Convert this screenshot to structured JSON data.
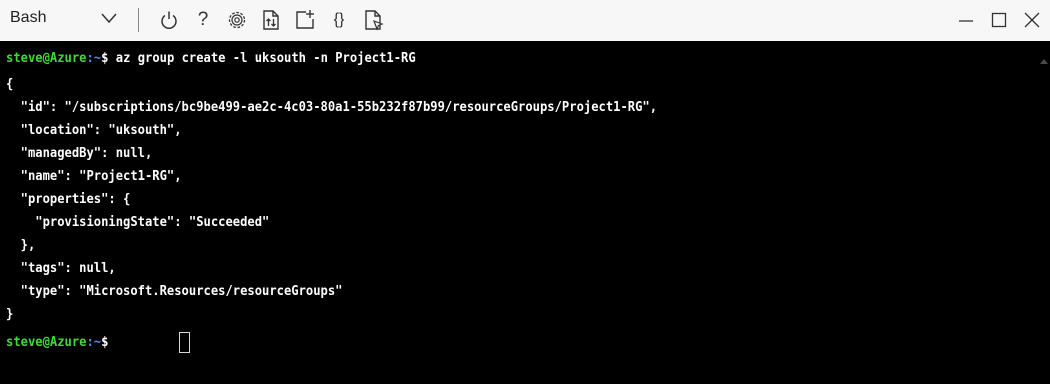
{
  "toolbar": {
    "shell_label": "Bash",
    "icons": {
      "chevron": "chevron-down-icon",
      "power": "power-icon",
      "help": "help-icon",
      "settings": "gear-icon",
      "upload": "upload-download-icon",
      "new_session": "new-session-icon",
      "editor": "braces-icon",
      "preview": "web-preview-icon"
    },
    "help_glyph": "?",
    "editor_glyph": "{}"
  },
  "window": {
    "icons": [
      "minimize-icon",
      "maximize-icon",
      "close-icon"
    ]
  },
  "terminal": {
    "prompt": {
      "user": "steve",
      "at": "@",
      "host": "Azure",
      "sep": ":~",
      "symbol": "$"
    },
    "command": " az group create -l uksouth -n Project1-RG",
    "output_lines": [
      "{",
      "  \"id\": \"/subscriptions/bc9be499-ae2c-4c03-80a1-55b232f87b99/resourceGroups/Project1-RG\",",
      "  \"location\": \"uksouth\",",
      "  \"managedBy\": null,",
      "  \"name\": \"Project1-RG\",",
      "  \"properties\": {",
      "    \"provisioningState\": \"Succeeded\"",
      "  },",
      "  \"tags\": null,",
      "  \"type\": \"Microsoft.Resources/resourceGroups\"",
      "}"
    ],
    "colors": {
      "background": "#000000",
      "text": "#ffffff",
      "prompt_user": "#3fd93a",
      "prompt_path": "#4e8fe8"
    }
  }
}
